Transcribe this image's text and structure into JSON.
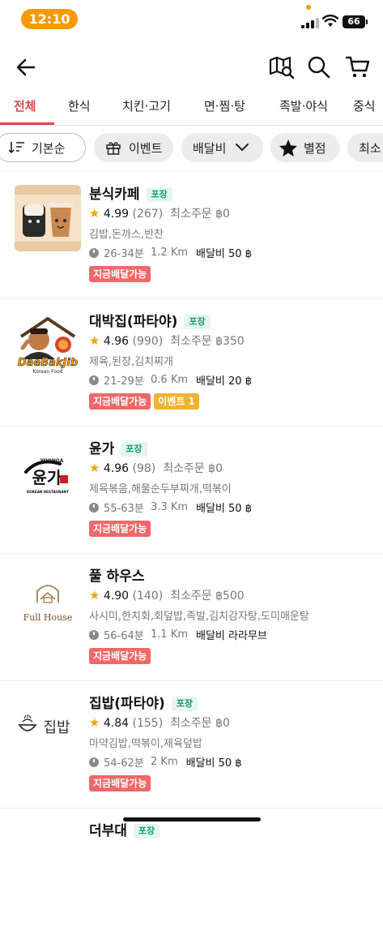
{
  "status_bar": {
    "time": "12:10",
    "battery": "66"
  },
  "tabs": [
    {
      "label": "전체",
      "active": true
    },
    {
      "label": "한식"
    },
    {
      "label": "치킨·고기"
    },
    {
      "label": "면·찜·탕"
    },
    {
      "label": "족발·야식"
    },
    {
      "label": "중식"
    }
  ],
  "filters": {
    "sort": "기본순",
    "event": "이벤트",
    "delivery_fee": "배달비",
    "rating": "별점",
    "min_order": "최소"
  },
  "restaurants": [
    {
      "name": "분식카페",
      "pack": "포장",
      "rating": "4.99",
      "reviews": "(267)",
      "min_order": "최소주문 ฿0",
      "menu": "김밥,돈까스,반찬",
      "time": "26-34분",
      "distance": "1.2 Km",
      "delivery": "배달비  50 ฿",
      "badges": [
        "지금배달가능"
      ]
    },
    {
      "name": "대박집(파타야)",
      "pack": "포장",
      "rating": "4.96",
      "reviews": "(990)",
      "min_order": "최소주문 ฿350",
      "menu": "제육,된장,김치찌개",
      "time": "21-29분",
      "distance": "0.6 Km",
      "delivery": "배달비  20 ฿",
      "badges": [
        "지금배달가능",
        "이벤트 1"
      ],
      "logo_text": "DaeBakJib",
      "logo_sub": "Korean Food"
    },
    {
      "name": "윤가",
      "pack": "포장",
      "rating": "4.96",
      "reviews": "(98)",
      "min_order": "최소주문 ฿0",
      "menu": "제육볶음,해물순두부찌개,떡볶이",
      "time": "55-63분",
      "distance": "3.3 Km",
      "delivery": "배달비  50 ฿",
      "badges": [
        "지금배달가능"
      ],
      "logo_text": "윤가",
      "logo_sub": "KOREAN RESTAURANT",
      "logo_top": "YOONGA"
    },
    {
      "name": "풀 하우스",
      "pack": "",
      "rating": "4.90",
      "reviews": "(140)",
      "min_order": "최소주문 ฿500",
      "menu": "사시미,한치회,회덮밥,족발,김치감자탕,도미매운탕",
      "time": "56-64분",
      "distance": "1.1 Km",
      "delivery": "배달비  라라무브",
      "badges": [
        "지금배달가능"
      ],
      "logo_text": "Full House"
    },
    {
      "name": "집밥(파타야)",
      "pack": "포장",
      "rating": "4.84",
      "reviews": "(155)",
      "min_order": "최소주문 ฿0",
      "menu": "마약김밥,떡볶이,제육덮밥",
      "time": "54-62분",
      "distance": "2 Km",
      "delivery": "배달비  50 ฿",
      "badges": [
        "지금배달가능"
      ],
      "logo_text": "집밥"
    },
    {
      "name": "더부대",
      "pack": "포장"
    }
  ]
}
